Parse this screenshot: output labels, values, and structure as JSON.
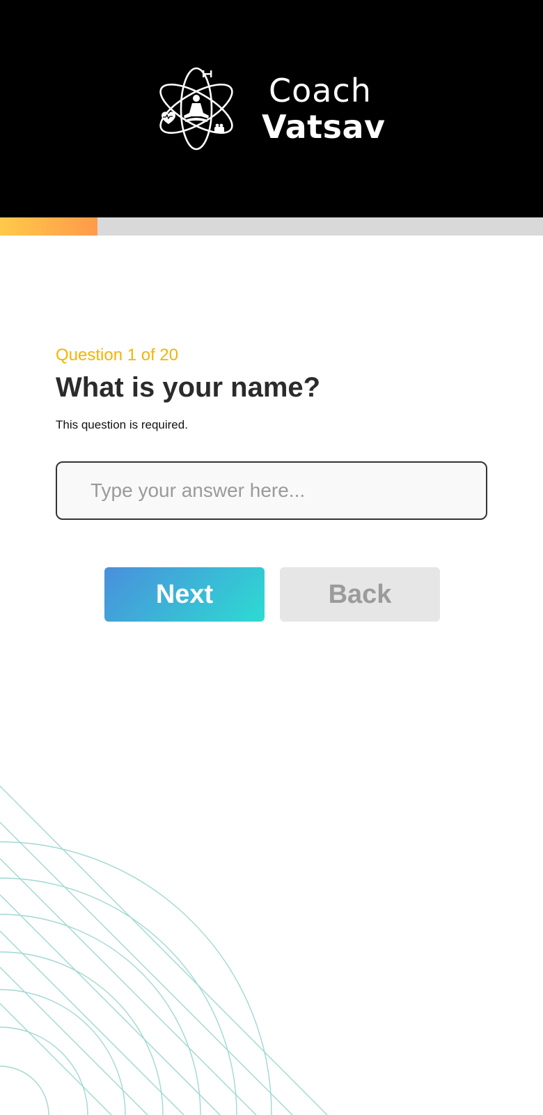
{
  "brand": {
    "line1": "Coach",
    "line2": "Vatsav",
    "logo_icon": "atom-meditation-logo-icon"
  },
  "progress": {
    "fraction": 0.18,
    "colors": {
      "fill_start": "#ffc94a",
      "fill_end": "#ff9a4a",
      "track": "#d9d9d9"
    }
  },
  "question": {
    "counter": "Question 1 of 20",
    "title": "What is your name?",
    "note": "This question is required."
  },
  "answer": {
    "value": "",
    "placeholder": "Type your answer here..."
  },
  "buttons": {
    "next_label": "Next",
    "back_label": "Back"
  },
  "colors": {
    "header_bg": "#000000",
    "counter": "#f5b400",
    "next_gradient_start": "#4a8fdc",
    "next_gradient_end": "#2ddbd2",
    "back_bg": "#e6e6e6",
    "decor_lines": "#9fd8d2"
  }
}
